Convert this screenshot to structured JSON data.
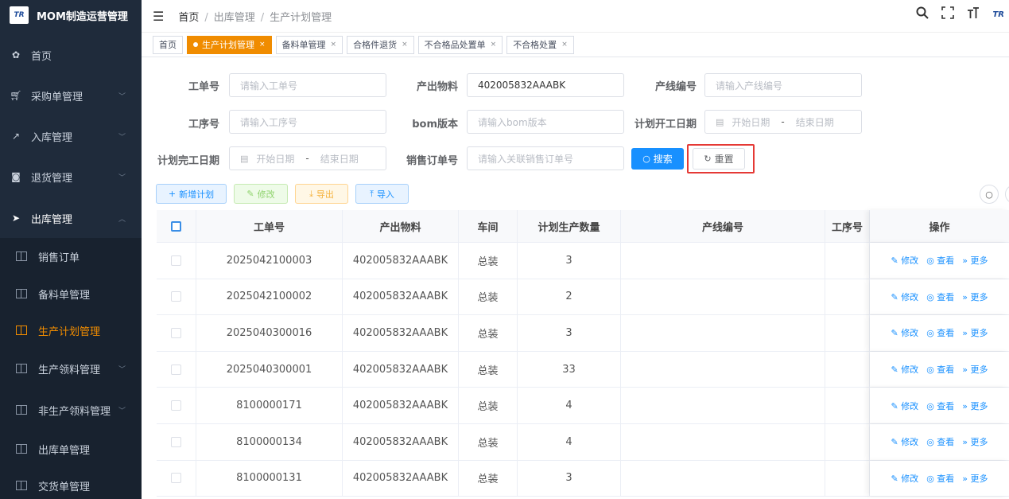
{
  "app": {
    "title": "MOM制造运营管理",
    "logo_text": "TR"
  },
  "sidebar": {
    "items": [
      {
        "label": "首页",
        "icon": "dashboard-icon",
        "expandable": false
      },
      {
        "label": "采购单管理",
        "icon": "cart-icon",
        "expandable": true
      },
      {
        "label": "入库管理",
        "icon": "import-icon",
        "expandable": true
      },
      {
        "label": "退货管理",
        "icon": "return-icon",
        "expandable": true
      },
      {
        "label": "出库管理",
        "icon": "send-icon",
        "expandable": true,
        "open": true
      }
    ],
    "sub_items": [
      {
        "label": "销售订单",
        "active": false,
        "expandable": false
      },
      {
        "label": "备料单管理",
        "active": false,
        "expandable": false
      },
      {
        "label": "生产计划管理",
        "active": true,
        "expandable": false
      },
      {
        "label": "生产领料管理",
        "active": false,
        "expandable": true
      },
      {
        "label": "非生产领料管理",
        "active": false,
        "expandable": true
      },
      {
        "label": "出库单管理",
        "active": false,
        "expandable": false
      },
      {
        "label": "交货单管理",
        "active": false,
        "expandable": false
      }
    ]
  },
  "header": {
    "breadcrumb": [
      "首页",
      "出库管理",
      "生产计划管理"
    ]
  },
  "tags": [
    {
      "label": "首页",
      "active": false,
      "closable": false
    },
    {
      "label": "生产计划管理",
      "active": true,
      "closable": true
    },
    {
      "label": "备料单管理",
      "active": false,
      "closable": true
    },
    {
      "label": "合格件退货",
      "active": false,
      "closable": true
    },
    {
      "label": "不合格品处置单",
      "active": false,
      "closable": true
    },
    {
      "label": "不合格处置",
      "active": false,
      "closable": true
    }
  ],
  "filters": {
    "order_no": {
      "label": "工单号",
      "placeholder": "请输入工单号"
    },
    "material": {
      "label": "产出物料",
      "value": "402005832AAABK"
    },
    "line_no": {
      "label": "产线编号",
      "placeholder": "请输入产线编号"
    },
    "process_no": {
      "label": "工序号",
      "placeholder": "请输入工序号"
    },
    "bom": {
      "label": "bom版本",
      "placeholder": "请输入bom版本"
    },
    "plan_start": {
      "label": "计划开工日期",
      "start": "开始日期",
      "sep": "-",
      "end": "结束日期"
    },
    "plan_end": {
      "label": "计划完工日期",
      "start": "开始日期",
      "sep": "-",
      "end": "结束日期"
    },
    "sales_order": {
      "label": "销售订单号",
      "placeholder": "请输入关联销售订单号"
    },
    "search_label": "搜索",
    "reset_label": "重置"
  },
  "actions": {
    "add": "新增计划",
    "edit": "修改",
    "export": "导出",
    "import": "导入"
  },
  "table": {
    "columns": [
      "工单号",
      "产出物料",
      "车间",
      "计划生产数量",
      "产线编号",
      "工序号",
      "操作"
    ],
    "row_actions": {
      "edit": "修改",
      "view": "查看",
      "more": "更多"
    },
    "rows": [
      {
        "order_no": "2025042100003",
        "material": "402005832AAABK",
        "workshop": "总装",
        "qty": "3",
        "line": "",
        "process": ""
      },
      {
        "order_no": "2025042100002",
        "material": "402005832AAABK",
        "workshop": "总装",
        "qty": "2",
        "line": "",
        "process": ""
      },
      {
        "order_no": "2025040300016",
        "material": "402005832AAABK",
        "workshop": "总装",
        "qty": "3",
        "line": "",
        "process": ""
      },
      {
        "order_no": "2025040300001",
        "material": "402005832AAABK",
        "workshop": "总装",
        "qty": "33",
        "line": "",
        "process": ""
      },
      {
        "order_no": "8100000171",
        "material": "402005832AAABK",
        "workshop": "总装",
        "qty": "4",
        "line": "",
        "process": ""
      },
      {
        "order_no": "8100000134",
        "material": "402005832AAABK",
        "workshop": "总装",
        "qty": "4",
        "line": "",
        "process": ""
      },
      {
        "order_no": "8100000131",
        "material": "402005832AAABK",
        "workshop": "总装",
        "qty": "3",
        "line": "",
        "process": ""
      }
    ]
  }
}
